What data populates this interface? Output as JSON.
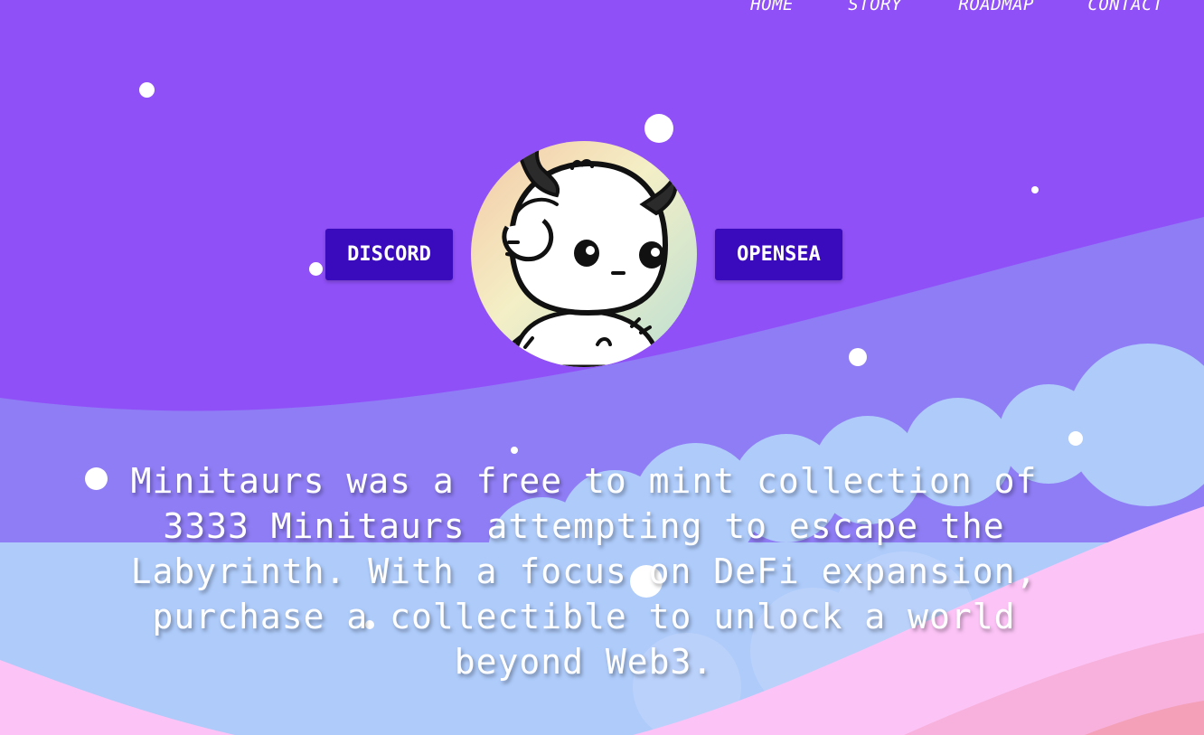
{
  "nav": {
    "items": [
      {
        "label": "HOME"
      },
      {
        "label": "STORY"
      },
      {
        "label": "ROADMAP"
      },
      {
        "label": "CONTACT"
      }
    ]
  },
  "hero": {
    "discord_label": "DISCORD",
    "opensea_label": "OPENSEA",
    "description": "Minitaurs was a free to mint collection of 3333 Minitaurs attempting to escape the Labyrinth. With a focus on DeFi expansion, purchase a collectible to unlock a world beyond Web3."
  },
  "colors": {
    "sky": "#9050f8",
    "wave": "#8f7df5",
    "cloud": "#aecbfa",
    "pink_hill": "#fcc4f6",
    "button": "#3a0bbd"
  },
  "icons": {
    "avatar": "minitaur-mascot-icon"
  }
}
